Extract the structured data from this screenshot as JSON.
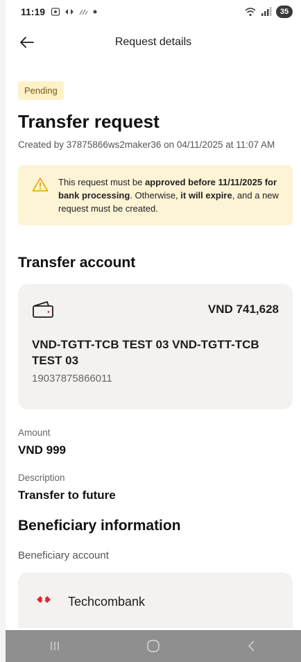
{
  "status_bar": {
    "time": "11:19",
    "battery": "35"
  },
  "header": {
    "title": "Request details"
  },
  "request": {
    "status_badge": "Pending",
    "title": "Transfer request",
    "created_text": "Created by 37875866ws2maker36 on 04/11/2025 at 11:07 AM"
  },
  "warning": {
    "text_1": "This request must be ",
    "bold_1": "approved before 11/11/2025 for bank processing",
    "text_2": ". Otherwise, ",
    "bold_2": "it will expire",
    "text_3": ", and a new request must be created."
  },
  "transfer_account": {
    "section_title": "Transfer account",
    "balance": "VND 741,628",
    "account_name": "VND-TGTT-TCB TEST 03 VND-TGTT-TCB TEST 03",
    "account_number": "19037875866011"
  },
  "amount": {
    "label": "Amount",
    "value": "VND 999"
  },
  "description": {
    "label": "Description",
    "value": "Transfer to future"
  },
  "beneficiary": {
    "section_title": "Beneficiary information",
    "account_label": "Beneficiary account",
    "bank_name": "Techcombank"
  },
  "icons": {
    "back": "arrow-left-icon",
    "warning": "warning-triangle-icon",
    "wallet": "wallet-icon",
    "bank_logo": "techcombank-logo"
  },
  "colors": {
    "badge_bg": "#fdf1c7",
    "warning_bg": "#fdf3d5",
    "card_bg": "#f3f2f1",
    "brand_red": "#e3262b"
  }
}
